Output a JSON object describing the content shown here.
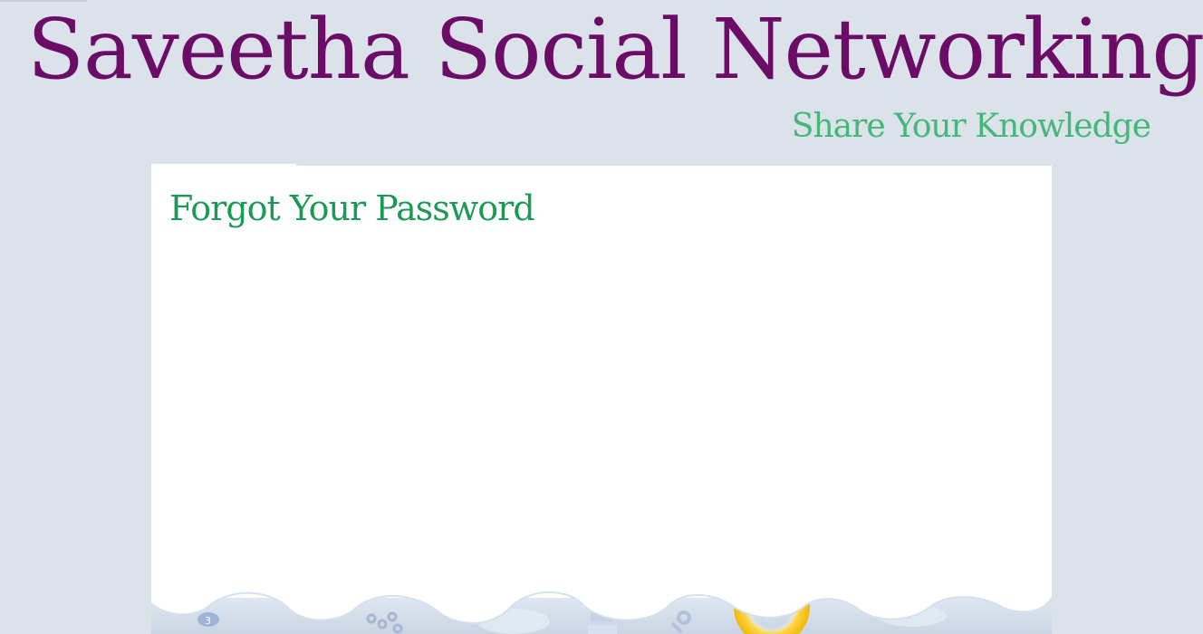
{
  "header": {
    "title": "Saveetha Social Networking",
    "tagline": "Share Your Knowledge"
  },
  "panel": {
    "heading": "Forgot Your Password"
  },
  "colors": {
    "title": "#6b0d67",
    "tagline": "#43b878",
    "heading": "#1a9a55",
    "background": "#dbe2ea",
    "panel": "#ffffff"
  },
  "decor": {
    "footer_icons": [
      "sun-icon",
      "computer-icon",
      "network-icon",
      "magnifier-icon",
      "badge-icon"
    ]
  }
}
